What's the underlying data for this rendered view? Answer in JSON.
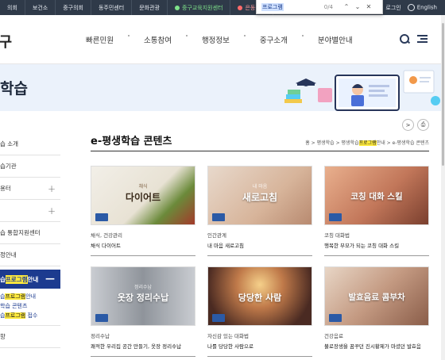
{
  "topbar": {
    "items": [
      "의회",
      "보건소",
      "중구의회",
      "동주민센터",
      "문화관광",
      "중구교육지원센터",
      "은동중구"
    ],
    "login": "로그인",
    "lang": "English"
  },
  "findbar": {
    "query": "프로그램",
    "count": "0/4",
    "up": "⌃",
    "down": "⌄",
    "close": "✕"
  },
  "header": {
    "logo": "중구",
    "nav": [
      "빠른민원",
      "소통참여",
      "행정정보",
      "중구소개",
      "분야별안내"
    ]
  },
  "banner": {
    "title": "학습"
  },
  "sidebar": {
    "items": [
      {
        "label": "습 소개",
        "plus": false
      },
      {
        "label": "습기관",
        "plus": false
      },
      {
        "label": "용터",
        "plus": true
      },
      {
        "label": "",
        "plus": true
      },
      {
        "label": "습 통합지원센터",
        "plus": false
      },
      {
        "label": "정안내",
        "plus": false
      }
    ],
    "active": {
      "pre": "습",
      "hl": "프로그램",
      "post": "안내"
    },
    "sub": [
      {
        "pre": "습",
        "hl": "프로그램",
        "post": "안내"
      },
      {
        "pre": "학습 콘텐츠",
        "hl": "",
        "post": ""
      },
      {
        "pre": "습",
        "hl": "프로그램",
        "post": " 접수"
      }
    ],
    "last": "항"
  },
  "content": {
    "title": "e-평생학습 콘텐츠",
    "share": ">",
    "print": "⎙",
    "breadcrumb": {
      "home": "홈",
      "sep": " > ",
      "b1": "평생학습",
      "b2pre": "평생학습",
      "b2hl": "프로그램",
      "b2post": "안내",
      "b3": "e-평생학습 콘텐츠"
    },
    "cards": [
      {
        "thumb_title": "다이어트",
        "thumb_small": "채식",
        "category": "채식, 건강관리",
        "name": "채식 다이어트",
        "bg": "#6b7a3a"
      },
      {
        "thumb_title": "새로고침",
        "thumb_small": "내 마음",
        "category": "인간관계",
        "name": "내 마음 새로고침",
        "bg": "#c9a48a"
      },
      {
        "thumb_title": "코칭 대화 스킬",
        "thumb_small": "",
        "category": "코칭 대화법",
        "name": "행복한 부모가 되는 코칭 대화 스킬",
        "bg": "#b96d4f"
      },
      {
        "thumb_title": "옷장 정리수납",
        "thumb_small": "정리수납",
        "category": "정리수납",
        "name": "쾌적한 우리집 공간 만들기, 옷장 정리수납",
        "bg": "#9b9fa6"
      },
      {
        "thumb_title": "당당한 사람",
        "thumb_small": "",
        "category": "자신감 있는 대화법",
        "name": "나를 당당한 사람으로",
        "bg": "#7a4a3a"
      },
      {
        "thumb_title": "발효음료 콤부차",
        "thumb_small": "",
        "category": "건강음료",
        "name": "불로장생을 꿈꾸던 진시황제가 마셨던 발효음",
        "bg": "#b88b74"
      }
    ]
  },
  "colors": {
    "topbar": "#2f3a49",
    "active": "#1d3b8f",
    "highlight": "#ffea3d",
    "banner": "#ebf2fb"
  }
}
